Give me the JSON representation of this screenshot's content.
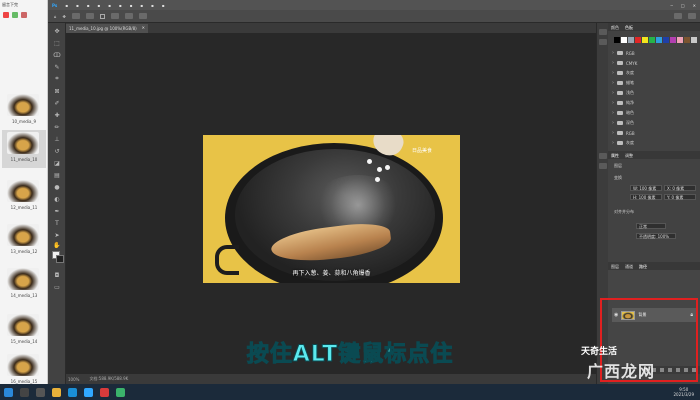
{
  "file_strip": {
    "header": "留言下完",
    "thumbnails": [
      {
        "label": "10_media_9",
        "selected": false
      },
      {
        "label": "11_media_10",
        "selected": true
      },
      {
        "label": "12_media_11",
        "selected": false
      },
      {
        "label": "13_media_12",
        "selected": false
      },
      {
        "label": "14_media_13",
        "selected": false
      },
      {
        "label": "15_media_14",
        "selected": false
      },
      {
        "label": "16_media_15",
        "selected": false
      }
    ]
  },
  "document": {
    "tab_title": "11_media_10.jpg @ 100%(RGB/8)",
    "zoom": "100%",
    "doc_info": "文档:588.9K/588.9K"
  },
  "photo": {
    "watermark": "日品美食",
    "subtitle": "再下入葱、姜、蒜和八角爆香"
  },
  "caption": "按住ALT键鼠标点住",
  "panels": {
    "swatches_tabs": [
      "颜色",
      "色板"
    ],
    "swatch_colors": [
      "#000000",
      "#ffffff",
      "#9aa7b3",
      "#e02626",
      "#f2e41d",
      "#26b34a",
      "#2f9fe0",
      "#1f3fa8",
      "#b23fb0",
      "#f0a3b8",
      "#7b5430",
      "#c9c9c9"
    ],
    "library_folders": [
      "RGB",
      "CMYK",
      "灰度",
      "蜡笔",
      "浅色",
      "纯净",
      "暗色",
      "深色",
      "RGB",
      "灰度"
    ],
    "properties_tabs": [
      "属性",
      "调整"
    ],
    "properties": {
      "section": "图层",
      "transform_title": "变换",
      "w": "W: 100 像素",
      "h": "H: 100 像素",
      "x": "X: 0 像素",
      "y": "Y: 0 像素",
      "align_title": "对齐并分布",
      "blend": "正常",
      "opacity": "不透明度: 100%"
    },
    "layers_tabs": [
      "图层",
      "通道",
      "路径"
    ],
    "layer_name": "背景"
  },
  "brand": {
    "top": "天奇生活",
    "big": "广西龙网"
  },
  "taskbar": {
    "time": "9:50",
    "date": "2021/3/29"
  }
}
